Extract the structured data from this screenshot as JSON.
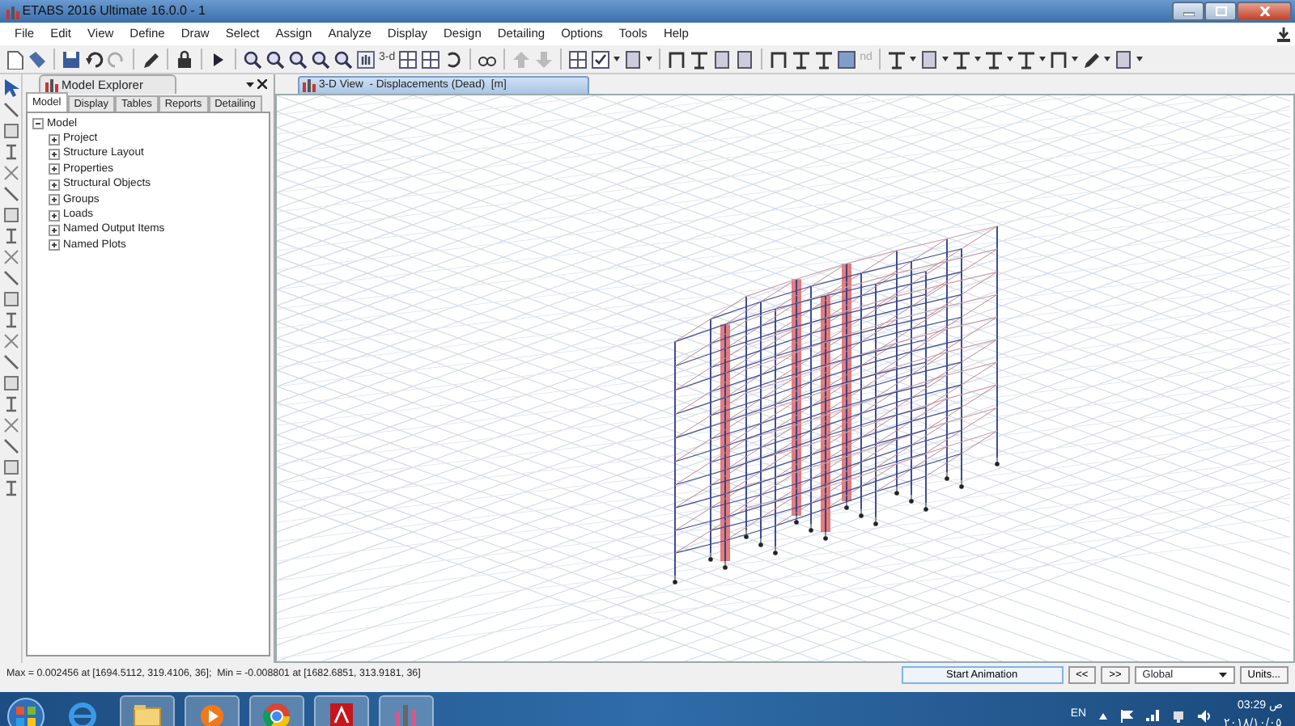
{
  "window": {
    "title": "ETABS 2016 Ultimate 16.0.0 - 1"
  },
  "menu": [
    "File",
    "Edit",
    "View",
    "Define",
    "Draw",
    "Select",
    "Assign",
    "Analyze",
    "Display",
    "Design",
    "Detailing",
    "Options",
    "Tools",
    "Help"
  ],
  "toolbar": {
    "texts": [
      "3-d",
      "nd"
    ]
  },
  "model_explorer": {
    "title": "Model Explorer",
    "tabs": [
      {
        "label": "Model",
        "selected": true
      },
      {
        "label": "Display",
        "selected": false
      },
      {
        "label": "Tables",
        "selected": false
      },
      {
        "label": "Reports",
        "selected": false
      },
      {
        "label": "Detailing",
        "selected": false
      }
    ],
    "tree": [
      {
        "label": "Model",
        "expanded": true,
        "children": [
          {
            "label": "Project",
            "expanded": false
          },
          {
            "label": "Structure Layout",
            "expanded": false
          },
          {
            "label": "Properties",
            "expanded": false
          },
          {
            "label": "Structural Objects",
            "expanded": false
          },
          {
            "label": "Groups",
            "expanded": false
          },
          {
            "label": "Loads",
            "expanded": false
          },
          {
            "label": "Named Output Items",
            "expanded": false
          },
          {
            "label": "Named Plots",
            "expanded": false
          }
        ]
      }
    ]
  },
  "view": {
    "tab_title": "3-D View  - Displacements (Dead)  [m]"
  },
  "status_bar": {
    "text": "Max = 0.002456 at [1694.5112, 319.4106, 36];  Min = -0.008801 at [1682.6851, 313.9181, 36]",
    "animation_button": "Start Animation",
    "prev_button": "<<",
    "next_button": ">>",
    "coordinate_system": "Global",
    "units_button": "Units..."
  },
  "taskbar": {
    "language": "EN",
    "time": "ص 03:29",
    "date": "٢٠١٨/١٠/٠٥"
  }
}
